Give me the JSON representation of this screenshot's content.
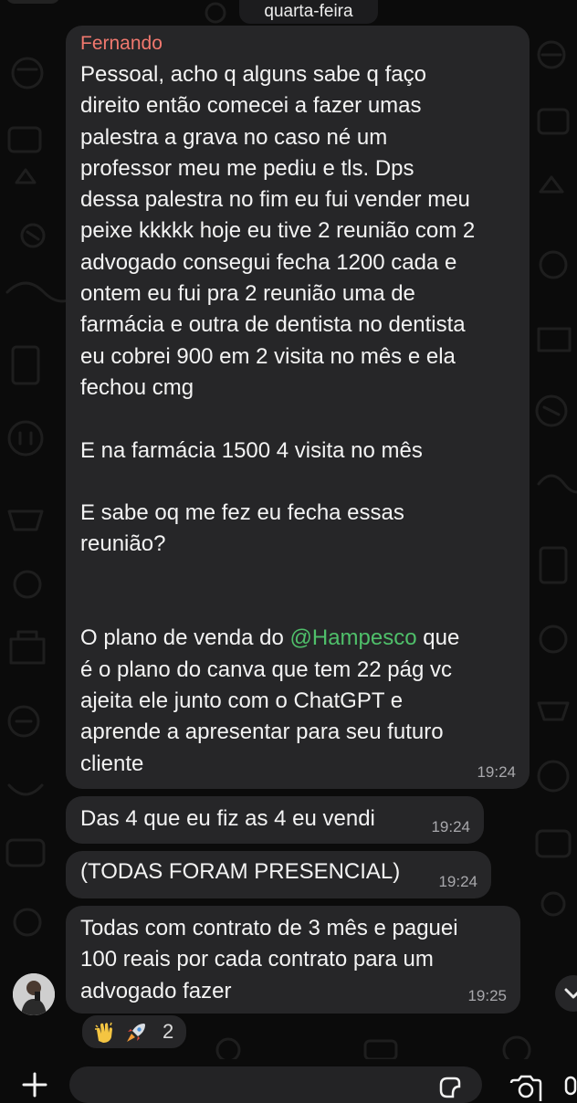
{
  "date_separator": "quarta-feira",
  "messages": [
    {
      "sender": "Fernando",
      "sender_color": "#f0786e",
      "text_before_mention": "Pessoal, acho q alguns sabe q faço\ndireito então comecei a fazer umas\npalestra a grava no caso né um\nprofessor meu me pediu e tls. Dps\ndessa palestra no fim eu fui vender meu\npeixe kkkkk hoje eu tive 2 reunião com 2\nadvogado consegui fecha 1200 cada e\nontem eu fui pra 2 reunião uma de\nfarmácia e outra de dentista no dentista\neu cobrei 900 em 2 visita no mês e ela\nfechou cmg\n\nE na farmácia 1500 4 visita no mês\n\nE sabe oq me fez eu fecha essas\nreunião?\n\n\nO plano de venda do ",
      "mention": "@Hampesco",
      "mention_color": "#4fbf6a",
      "text_after_mention": " que\né o plano do canva que tem 22 pág vc\najeita ele junto com o ChatGPT e\naprende a apresentar para seu futuro\ncliente",
      "time": "19:24"
    },
    {
      "text": "Das 4 que eu fiz as 4 eu vendi",
      "time": "19:24"
    },
    {
      "text": "(TODAS FORAM PRESENCIAL)",
      "time": "19:24"
    },
    {
      "text": "Todas com contrato de 3 mês e paguei\n100 reais por cada contrato para um\nadvogado fazer",
      "time": "19:25",
      "reactions": {
        "emojis": [
          "clapping-hands-emoji",
          "rocket-emoji"
        ],
        "count": "2"
      }
    }
  ],
  "icons": {
    "avatar": "avatar",
    "scroll_down": "chevron-down-icon",
    "attach": "plus-icon",
    "sticker": "sticker-icon",
    "camera": "camera-icon",
    "mic": "microphone-icon"
  },
  "colors": {
    "background": "#0b0b0b",
    "bubble": "#262628",
    "timestamp": "#a8a8ac"
  }
}
